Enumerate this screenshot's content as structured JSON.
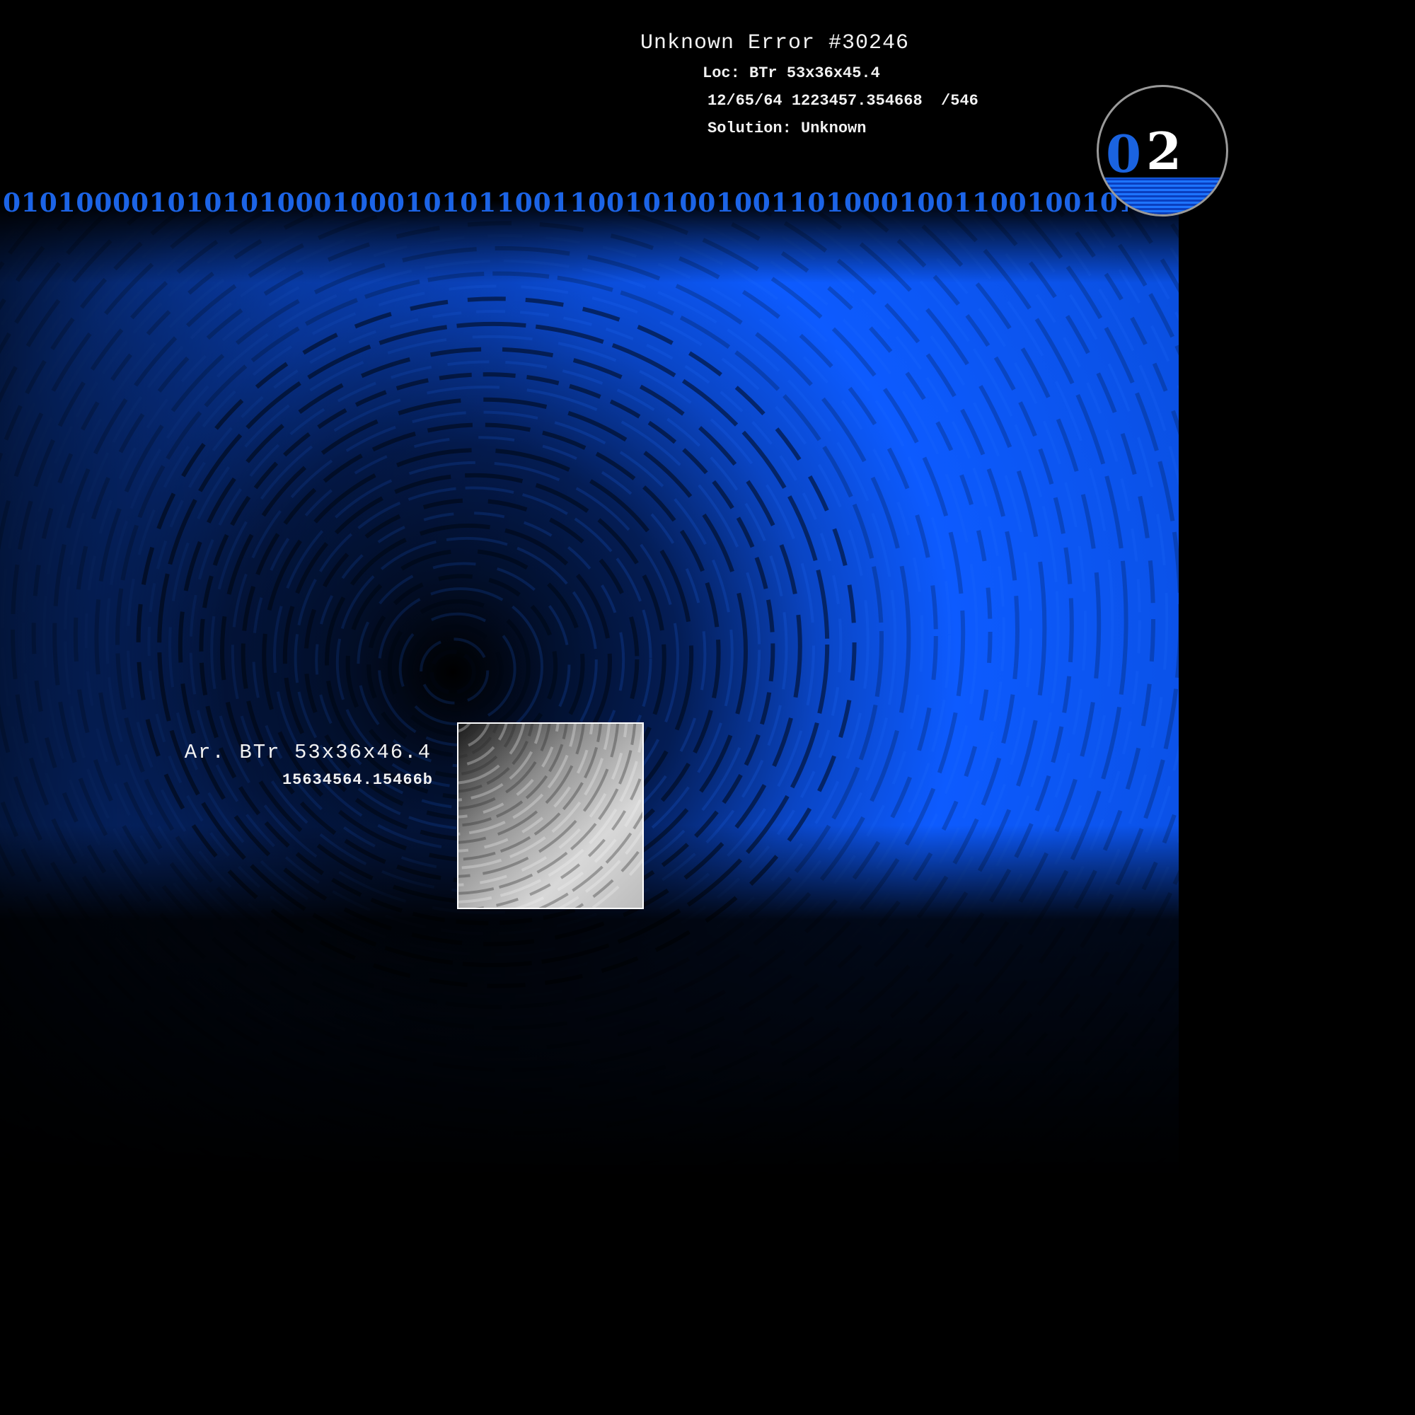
{
  "error": {
    "title": "Unknown Error #30246",
    "loc": "Loc: BTr 53x36x45.4",
    "stamp": "12/65/64 1223457.354668  /546",
    "solution": "Solution: Unknown"
  },
  "binary_strip": "01010000101010100010001010110011001010010011010001001100100101",
  "counter": {
    "digit_blue": "0",
    "digit_white": "2"
  },
  "sample": {
    "label": "Ar. BTr 53x36x46.4",
    "value": "15634564.15466b"
  },
  "colors": {
    "background": "#000000",
    "vortex_blue": "#0d5bff",
    "binary_blue": "#1c64e6",
    "text": "#f2f2f2",
    "badge_ring": "#9a9a9a"
  }
}
